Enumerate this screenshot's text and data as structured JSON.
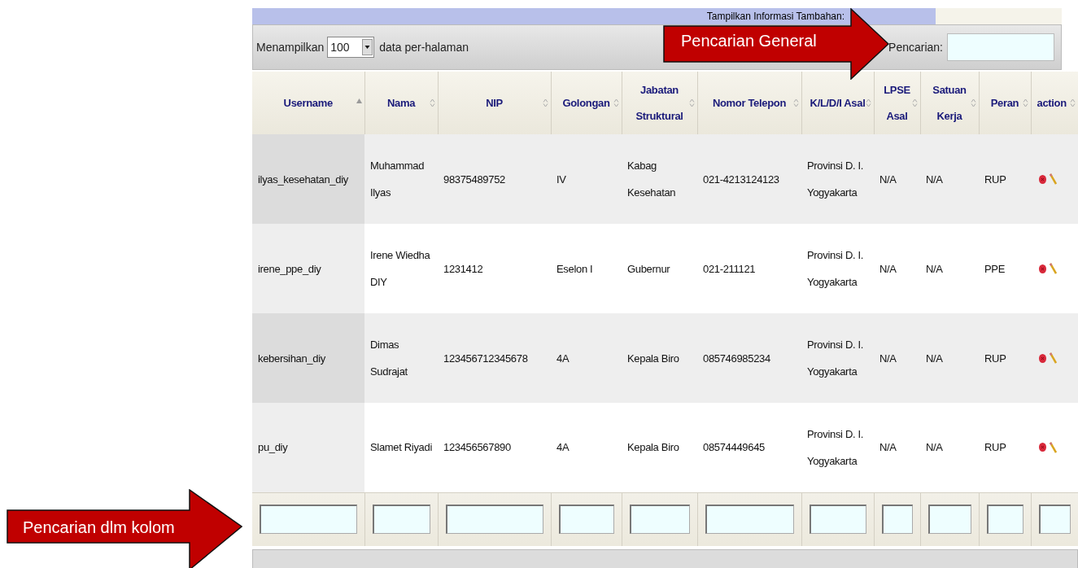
{
  "info_bar": {
    "label": "Tampilkan Informasi Tambahan:"
  },
  "toolbar": {
    "show_label": "Menampilkan",
    "page_size": "100",
    "per_page_label": "data per-halaman",
    "search_label": "Pencarian:"
  },
  "table": {
    "columns": [
      {
        "label": "Username",
        "sorted": true
      },
      {
        "label": "Nama",
        "sorted": false
      },
      {
        "label": "NIP",
        "sorted": false
      },
      {
        "label": "Golongan",
        "sorted": false
      },
      {
        "label": "Jabatan Struktural",
        "sorted": false
      },
      {
        "label": "Nomor Telepon",
        "sorted": false
      },
      {
        "label": "K/L/D/I Asal",
        "sorted": false
      },
      {
        "label": "LPSE Asal",
        "sorted": false
      },
      {
        "label": "Satuan Kerja",
        "sorted": false
      },
      {
        "label": "Peran",
        "sorted": false
      },
      {
        "label": "action",
        "sorted": false
      }
    ],
    "rows": [
      {
        "cells": [
          "ilyas_kesehatan_diy",
          "Muhammad Ilyas",
          "98375489752",
          "IV",
          "Kabag Kesehatan",
          "021-4213124123",
          "Provinsi D. I. Yogyakarta",
          "N/A",
          "N/A",
          "RUP"
        ]
      },
      {
        "cells": [
          "irene_ppe_diy",
          "Irene Wiedha DIY",
          "1231412",
          "Eselon I",
          "Gubernur",
          "021-211121",
          "Provinsi D. I. Yogyakarta",
          "N/A",
          "N/A",
          "PPE"
        ]
      },
      {
        "cells": [
          "kebersihan_diy",
          "Dimas Sudrajat",
          "123456712345678",
          "4A",
          "Kepala Biro",
          "085746985234",
          "Provinsi D. I. Yogyakarta",
          "N/A",
          "N/A",
          "RUP"
        ]
      },
      {
        "cells": [
          "pu_diy",
          "Slamet Riyadi",
          "123456567890",
          "4A",
          "Kepala Biro",
          "08574449645",
          "Provinsi D. I. Yogyakarta",
          "N/A",
          "N/A",
          "RUP"
        ]
      }
    ]
  },
  "annotations": [
    {
      "text": "Pencarian General"
    },
    {
      "text": "Pencarian dlm kolom"
    }
  ]
}
